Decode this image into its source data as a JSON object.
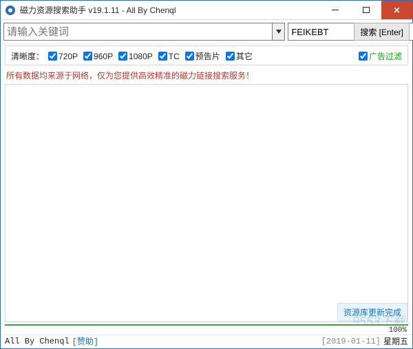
{
  "window": {
    "title": "磁力资源搜索助手 v19.1.11 - All By Chenql"
  },
  "search": {
    "placeholder": "请输入关键词",
    "value": "",
    "source_selected": "FEIKEBT",
    "button_label": "搜索 [Enter]"
  },
  "filters": {
    "label": "清晰度：",
    "options": [
      {
        "id": "720p",
        "label": "720P",
        "checked": true
      },
      {
        "id": "960p",
        "label": "960P",
        "checked": true
      },
      {
        "id": "1080p",
        "label": "1080P",
        "checked": true
      },
      {
        "id": "tc",
        "label": "TC",
        "checked": true
      },
      {
        "id": "trailer",
        "label": "预告片",
        "checked": true
      },
      {
        "id": "other",
        "label": "其它",
        "checked": true
      }
    ],
    "ad_filter_label": "广告过滤",
    "ad_filter_checked": true
  },
  "notice": "所有数据均来源于网络，仅为您提供高效精准的磁力链接搜索服务！",
  "update_badge": "资源库更新完成",
  "progress": {
    "percent_text": "100%"
  },
  "status": {
    "author": "All By Chenql",
    "donate": "[赞助]",
    "date": "[2019-01-11]",
    "weekday": "星期五"
  },
  "watermark": "9553下载"
}
